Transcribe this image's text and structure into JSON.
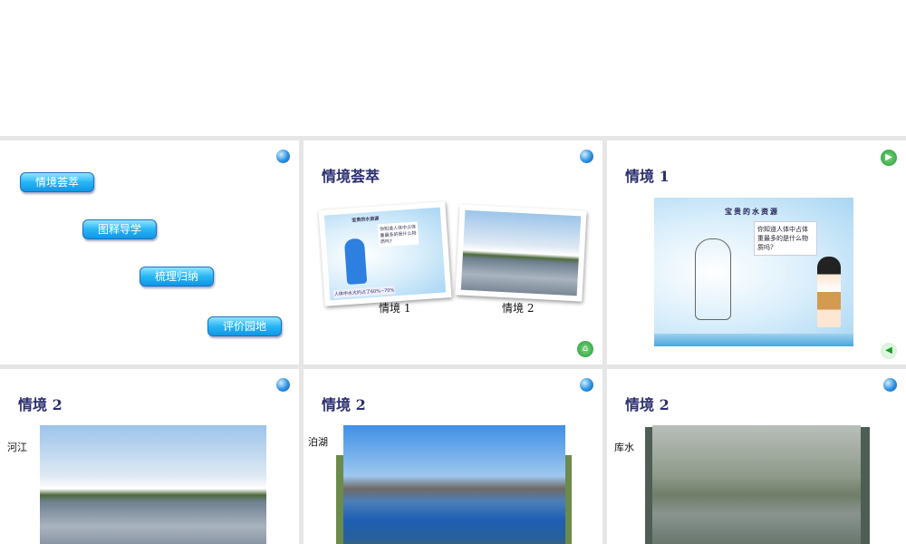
{
  "slides": [
    {
      "nav_buttons": [
        "情境荟萃",
        "图释导学",
        "梳理归纳",
        "评价园地"
      ]
    },
    {
      "title": "情境荟萃",
      "captions": [
        "情境 1",
        "情境 2"
      ],
      "thumb1": {
        "title": "宝贵的水资源",
        "bubble": "你知道人体中占体重最多的是什么物质吗?",
        "footer": "人体中水大约占了60%~70%"
      }
    },
    {
      "title": "情境 1",
      "card": {
        "title": "宝贵的水资源",
        "bubble": "你知道人体中占体重最多的是什么物质吗?"
      }
    },
    {
      "title": "情境 2",
      "label": "河江"
    },
    {
      "title": "情境 2",
      "label": "泊湖"
    },
    {
      "title": "情境 2",
      "label": "库水"
    }
  ]
}
